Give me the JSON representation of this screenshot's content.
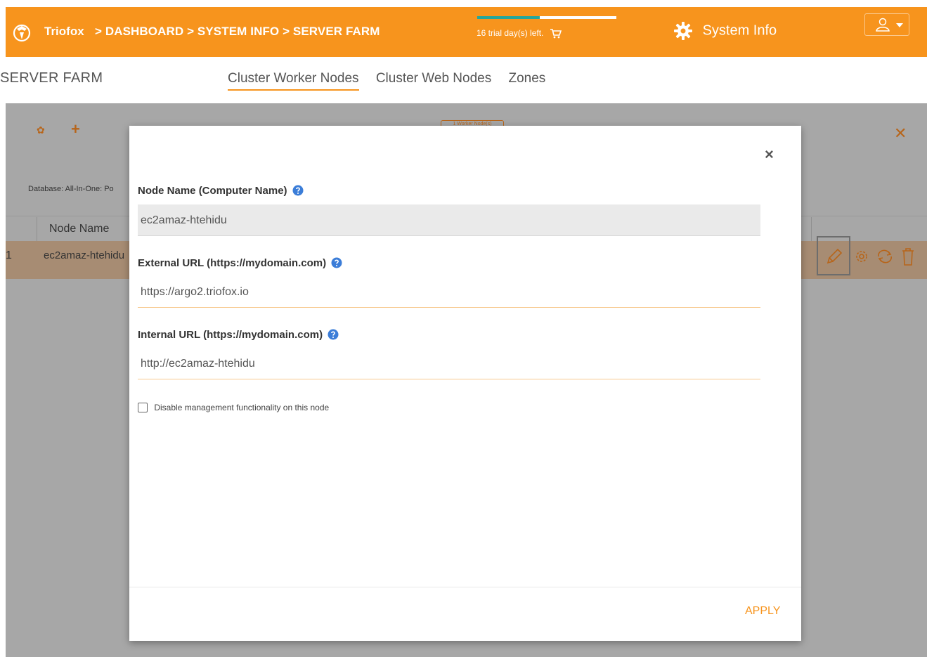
{
  "header": {
    "brand": "Triofox",
    "breadcrumb": "> DASHBOARD > SYSTEM INFO > SERVER FARM",
    "trial_text": "16 trial day(s) left.",
    "trial_progress": 0.45,
    "system_info_label": "System Info",
    "accent_color": "#f7941d"
  },
  "page": {
    "title": "SERVER FARM",
    "tabs": [
      {
        "label": "Cluster Worker Nodes",
        "active": true
      },
      {
        "label": "Cluster Web Nodes",
        "active": false
      },
      {
        "label": "Zones",
        "active": false
      }
    ]
  },
  "background": {
    "badge_text": "1 Worker Node(s)",
    "database_text": "Database: All-In-One: Po",
    "column_header": "Node Name",
    "row_index": "1",
    "row_node_name": "ec2amaz-htehidu"
  },
  "modal": {
    "close_glyph": "×",
    "node_name_label": "Node Name (Computer Name)",
    "node_name_value": "ec2amaz-htehidu",
    "external_url_label": "External URL (https://mydomain.com)",
    "external_url_value": "https://argo2.triofox.io",
    "internal_url_label": "Internal URL (https://mydomain.com)",
    "internal_url_value": "http://ec2amaz-htehidu",
    "disable_mgmt_label": "Disable management functionality on this node",
    "disable_mgmt_checked": false,
    "apply_label": "APPLY"
  }
}
